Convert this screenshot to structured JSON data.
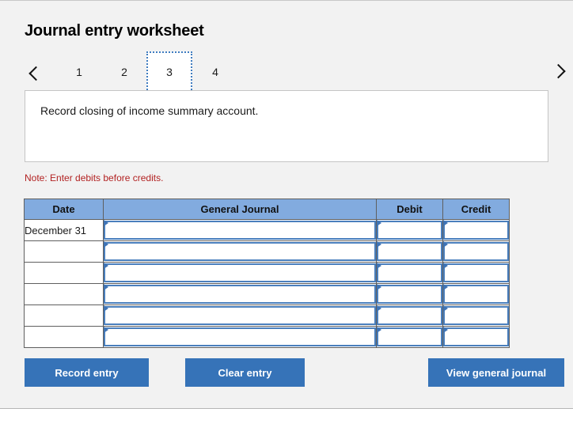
{
  "header": {
    "title": "Journal entry worksheet"
  },
  "pager": {
    "prev_icon": "chevron-left-icon",
    "next_icon": "chevron-right-icon",
    "active_index": 2,
    "tabs": [
      {
        "label": "1"
      },
      {
        "label": "2"
      },
      {
        "label": "3"
      },
      {
        "label": "4"
      }
    ]
  },
  "instruction": {
    "text": "Record closing of income summary account."
  },
  "note": {
    "text": "Note: Enter debits before credits."
  },
  "table": {
    "columns": [
      {
        "key": "date",
        "label": "Date"
      },
      {
        "key": "journal",
        "label": "General Journal"
      },
      {
        "key": "debit",
        "label": "Debit"
      },
      {
        "key": "credit",
        "label": "Credit"
      }
    ],
    "rows": [
      {
        "date": "December 31",
        "journal": "",
        "debit": "",
        "credit": ""
      },
      {
        "date": "",
        "journal": "",
        "debit": "",
        "credit": ""
      },
      {
        "date": "",
        "journal": "",
        "debit": "",
        "credit": ""
      },
      {
        "date": "",
        "journal": "",
        "debit": "",
        "credit": ""
      },
      {
        "date": "",
        "journal": "",
        "debit": "",
        "credit": ""
      },
      {
        "date": "",
        "journal": "",
        "debit": "",
        "credit": ""
      }
    ]
  },
  "buttons": {
    "record_entry": "Record entry",
    "clear_entry": "Clear entry",
    "view_general_journal": "View general journal"
  },
  "colors": {
    "panel_background": "#f2f2f2",
    "table_header_blue": "#82abdf",
    "button_blue": "#3673b8",
    "note_red": "#b22222",
    "active_tab_border": "#3f7cc0",
    "input_border_blue": "#4a7fbd"
  }
}
